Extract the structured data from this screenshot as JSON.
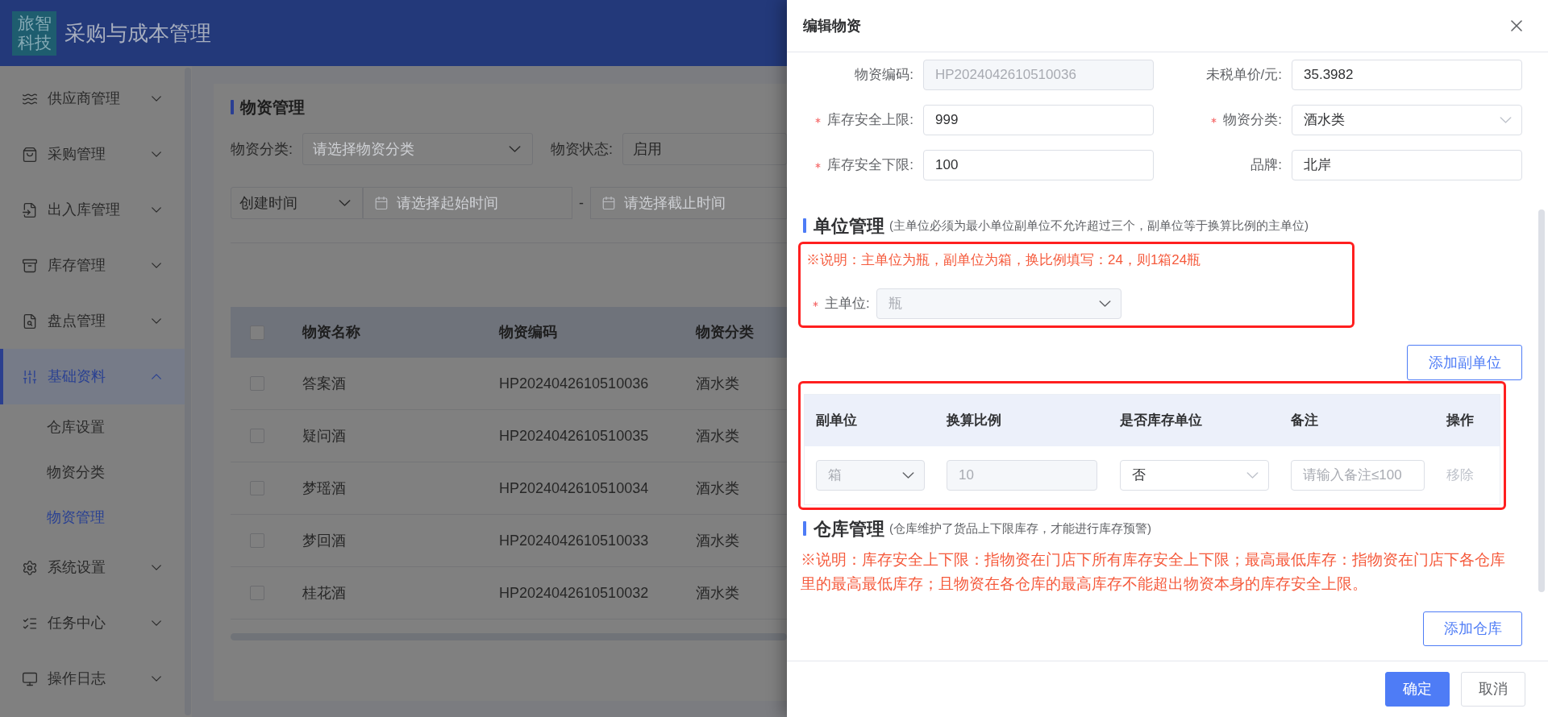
{
  "app": {
    "logo": [
      "旅智",
      "科技"
    ],
    "title": "采购与成本管理"
  },
  "sidebar": {
    "items": [
      {
        "label": "供应商管理",
        "selected": false,
        "expanded": false
      },
      {
        "label": "采购管理",
        "selected": false,
        "expanded": false
      },
      {
        "label": "出入库管理",
        "selected": false,
        "expanded": false
      },
      {
        "label": "库存管理",
        "selected": false,
        "expanded": false
      },
      {
        "label": "盘点管理",
        "selected": false,
        "expanded": false
      },
      {
        "label": "基础资料",
        "selected": true,
        "expanded": true,
        "children": [
          {
            "label": "仓库设置",
            "selected": false
          },
          {
            "label": "物资分类",
            "selected": false
          },
          {
            "label": "物资管理",
            "selected": true
          }
        ]
      },
      {
        "label": "系统设置",
        "selected": false,
        "expanded": false
      },
      {
        "label": "任务中心",
        "selected": false,
        "expanded": false
      },
      {
        "label": "操作日志",
        "selected": false,
        "expanded": false
      }
    ]
  },
  "page": {
    "title": "物资管理",
    "filters": [
      {
        "label": "物资分类:",
        "kind": "select",
        "placeholder": "请选择物资分类"
      },
      {
        "label": "物资状态:",
        "kind": "input",
        "value": "启用"
      }
    ],
    "date_filter": {
      "field": "创建时间",
      "start_placeholder": "请选择起始时间",
      "separator": "-",
      "end_placeholder": "请选择截止时间"
    },
    "table": {
      "all_checked": false,
      "columns": [
        "物资名称",
        "物资编码",
        "物资分类"
      ],
      "rows": [
        {
          "checked": false,
          "cells": [
            "答案酒",
            "HP2024042610510036",
            "酒水类"
          ]
        },
        {
          "checked": false,
          "cells": [
            "疑问酒",
            "HP2024042610510035",
            "酒水类"
          ]
        },
        {
          "checked": false,
          "cells": [
            "梦瑶酒",
            "HP2024042610510034",
            "酒水类"
          ]
        },
        {
          "checked": false,
          "cells": [
            "梦回酒",
            "HP2024042610510033",
            "酒水类"
          ]
        },
        {
          "checked": false,
          "cells": [
            "桂花酒",
            "HP2024042610510032",
            "酒水类"
          ]
        }
      ]
    }
  },
  "drawer": {
    "title": "编辑物资",
    "fields": [
      {
        "label": "物资编码:",
        "kind": "input",
        "value": "HP2024042610510036",
        "required": false,
        "disabled": true
      },
      {
        "label": "未税单价/元:",
        "kind": "input",
        "value": "35.3982",
        "required": false,
        "disabled": false
      },
      {
        "label": "库存安全上限:",
        "kind": "input",
        "value": "999",
        "required": true,
        "disabled": false
      },
      {
        "label": "物资分类:",
        "kind": "select",
        "value": "酒水类",
        "required": true,
        "disabled": false
      },
      {
        "label": "库存安全下限:",
        "kind": "input",
        "value": "100",
        "required": true,
        "disabled": false
      },
      {
        "label": "品牌:",
        "kind": "input",
        "value": "北岸",
        "required": false,
        "disabled": false
      }
    ],
    "unit_section": {
      "title": "单位管理",
      "hint": "(主单位必须为最小单位副单位不允许超过三个，副单位等于换算比例的主单位)",
      "note": "※说明：主单位为瓶，副单位为箱，换比例填写：24，则1箱24瓶",
      "main_unit": {
        "label": "主单位:",
        "kind": "select",
        "value": "瓶",
        "required": true,
        "disabled": true
      },
      "add_button": "添加副单位",
      "table": {
        "columns": [
          "副单位",
          "换算比例",
          "是否库存单位",
          "备注",
          "操作"
        ],
        "rows": [
          {
            "unit": {
              "value": "箱",
              "disabled": true
            },
            "ratio": {
              "value": "10",
              "disabled": true
            },
            "stock_unit": {
              "value": "否",
              "disabled": false
            },
            "remark": {
              "placeholder": "请输入备注≤100"
            },
            "action": {
              "label": "移除",
              "disabled": true
            }
          }
        ]
      }
    },
    "warehouse_section": {
      "title": "仓库管理",
      "hint": "(仓库维护了货品上下限库存，才能进行库存预警)",
      "note": "※说明：库存安全上下限：指物资在门店下所有库存安全上下限；最高最低库存：指物资在门店下各仓库里的最高最低库存；且物资在各仓库的最高库存不能超出物资本身的库存安全上限。",
      "add_button": "添加仓库"
    },
    "footer": {
      "buttons": [
        {
          "label": "确定",
          "kind": "primary"
        },
        {
          "label": "取消",
          "kind": "default"
        }
      ]
    }
  }
}
